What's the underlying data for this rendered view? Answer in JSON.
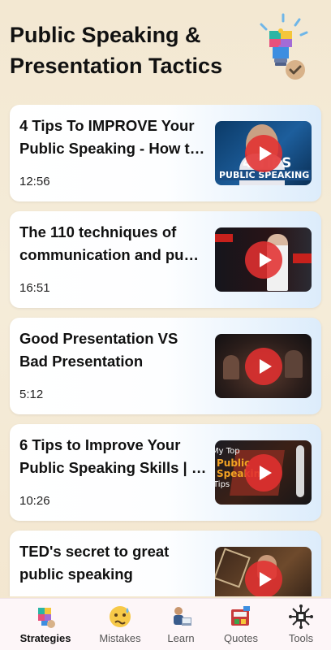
{
  "app": {
    "title_line1": "Public Speaking &",
    "title_line2": "Presentation Tactics",
    "logo_icon": "puzzle-lightbulb-icon"
  },
  "videos": [
    {
      "title_line1": "4 Tips To IMPROVE Your",
      "title_line2": "Public Speaking - How t…",
      "duration": "12:56",
      "thumb_text_1": "4 TIPS",
      "thumb_text_2": "PUBLIC SPEAKING"
    },
    {
      "title_line1": "The 110 techniques of",
      "title_line2": "communication and pu…",
      "duration": "16:51"
    },
    {
      "title_line1": "Good Presentation VS",
      "title_line2": "Bad Presentation",
      "duration": "5:12"
    },
    {
      "title_line1": "6 Tips to Improve Your",
      "title_line2": "Public Speaking Skills | …",
      "duration": "10:26",
      "thumb_text_1": "My Top",
      "thumb_text_2": "Public",
      "thumb_text_3": "Speaking",
      "thumb_text_4": "Tips"
    },
    {
      "title_line1": "TED's secret to great",
      "title_line2": "public speaking",
      "duration": ""
    }
  ],
  "nav": [
    {
      "label": "Strategies",
      "icon": "strategy-puzzle-icon",
      "active": true
    },
    {
      "label": "Mistakes",
      "icon": "worried-face-icon",
      "active": false
    },
    {
      "label": "Learn",
      "icon": "teacher-icon",
      "active": false
    },
    {
      "label": "Quotes",
      "icon": "quote-box-icon",
      "active": false
    },
    {
      "label": "Tools",
      "icon": "circuit-tools-icon",
      "active": false
    }
  ],
  "colors": {
    "play_button": "#e13030",
    "card_gradient_end": "#dcecfb",
    "background": "#f3e8d2"
  }
}
